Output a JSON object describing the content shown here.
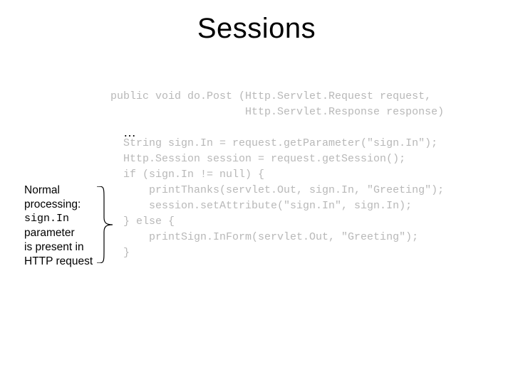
{
  "title": "Sessions",
  "ellipsis": "…",
  "code": {
    "l1": "public void do.Post (Http.Servlet.Request request,",
    "l2": "                     Http.Servlet.Response response)",
    "l3": "",
    "l4": "  String sign.In = request.getParameter(\"sign.In\");",
    "l5": "  Http.Session session = request.getSession();",
    "l6": "  if (sign.In != null) {",
    "l7": "      printThanks(servlet.Out, sign.In, \"Greeting\");",
    "l8": "      session.setAttribute(\"sign.In\", sign.In);",
    "l9": "  } else {",
    "l10": "      printSign.InForm(servlet.Out, \"Greeting\");",
    "l11": "  }"
  },
  "annotation": {
    "l1": "Normal",
    "l2": "processing:",
    "l3": "sign.In",
    "l4": "parameter",
    "l5": "is present in",
    "l6": "HTTP request"
  }
}
